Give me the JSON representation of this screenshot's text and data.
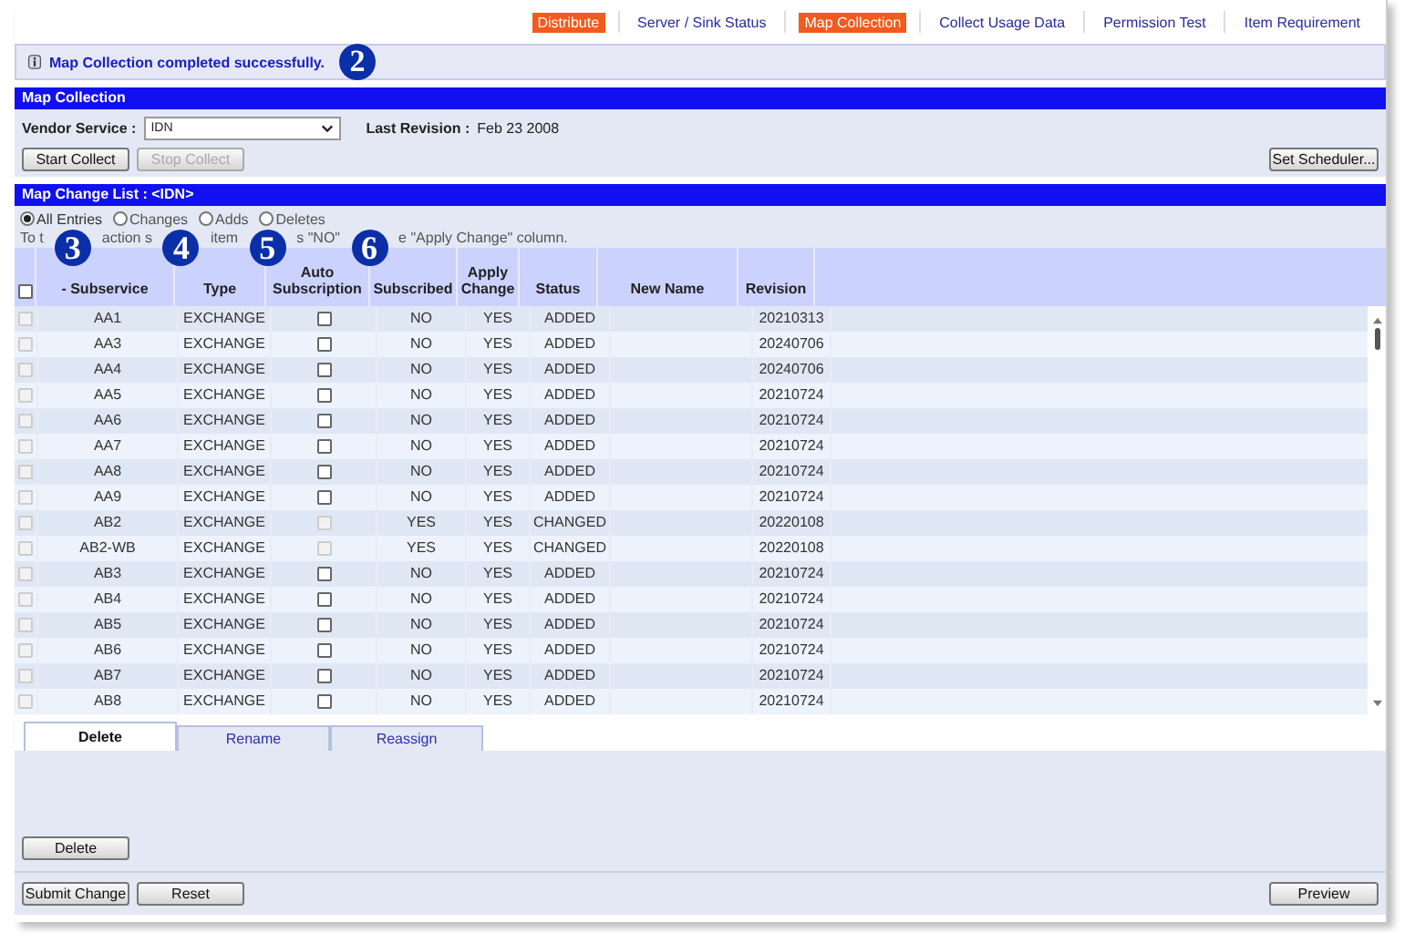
{
  "nav": [
    {
      "label": "Distribute",
      "highlighted": true
    },
    {
      "label": "Server / Sink Status",
      "highlighted": false
    },
    {
      "label": "Map Collection",
      "highlighted": true
    },
    {
      "label": "Collect Usage Data",
      "highlighted": false
    },
    {
      "label": "Permission Test",
      "highlighted": false
    },
    {
      "label": "Item Requirement",
      "highlighted": false
    }
  ],
  "message": {
    "text": "Map Collection completed successfully.",
    "callout": "2"
  },
  "map_collection": {
    "title": "Map Collection",
    "vendor_label": "Vendor Service :",
    "vendor_value": "IDN",
    "revision_label": "Last Revision :",
    "revision_value": "Feb 23 2008",
    "buttons": [
      {
        "label": "Start Collect",
        "disabled": false
      },
      {
        "label": "Stop Collect",
        "disabled": true
      }
    ],
    "scheduler_button": "Set Scheduler..."
  },
  "change_list": {
    "title": "Map Change List : <IDN>",
    "filters": [
      {
        "label": "All Entries",
        "selected": true
      },
      {
        "label": "Changes",
        "selected": false
      },
      {
        "label": "Adds",
        "selected": false
      },
      {
        "label": "Deletes",
        "selected": false
      }
    ],
    "hint_fragments": [
      "To t",
      "action s",
      "item",
      "s \"NO\"",
      "e \"Apply Change\" column."
    ],
    "callouts": [
      "3",
      "4",
      "5",
      "6"
    ],
    "select_all_checked": false,
    "columns": [
      "- Subservice",
      "Type",
      "Auto Subscription",
      "Subscribed",
      "Apply Change",
      "Status",
      "New Name",
      "Revision"
    ],
    "rows": [
      {
        "checked": false,
        "subservice": "AA1",
        "type": "EXCHANGE",
        "auto_checked": false,
        "auto_disabled": false,
        "subscribed": "NO",
        "apply": "YES",
        "status": "ADDED",
        "revision": "20210313"
      },
      {
        "checked": false,
        "subservice": "AA3",
        "type": "EXCHANGE",
        "auto_checked": false,
        "auto_disabled": false,
        "subscribed": "NO",
        "apply": "YES",
        "status": "ADDED",
        "revision": "20240706"
      },
      {
        "checked": false,
        "subservice": "AA4",
        "type": "EXCHANGE",
        "auto_checked": false,
        "auto_disabled": false,
        "subscribed": "NO",
        "apply": "YES",
        "status": "ADDED",
        "revision": "20240706"
      },
      {
        "checked": false,
        "subservice": "AA5",
        "type": "EXCHANGE",
        "auto_checked": false,
        "auto_disabled": false,
        "subscribed": "NO",
        "apply": "YES",
        "status": "ADDED",
        "revision": "20210724"
      },
      {
        "checked": false,
        "subservice": "AA6",
        "type": "EXCHANGE",
        "auto_checked": false,
        "auto_disabled": false,
        "subscribed": "NO",
        "apply": "YES",
        "status": "ADDED",
        "revision": "20210724"
      },
      {
        "checked": false,
        "subservice": "AA7",
        "type": "EXCHANGE",
        "auto_checked": false,
        "auto_disabled": false,
        "subscribed": "NO",
        "apply": "YES",
        "status": "ADDED",
        "revision": "20210724"
      },
      {
        "checked": false,
        "subservice": "AA8",
        "type": "EXCHANGE",
        "auto_checked": false,
        "auto_disabled": false,
        "subscribed": "NO",
        "apply": "YES",
        "status": "ADDED",
        "revision": "20210724"
      },
      {
        "checked": false,
        "subservice": "AA9",
        "type": "EXCHANGE",
        "auto_checked": false,
        "auto_disabled": false,
        "subscribed": "NO",
        "apply": "YES",
        "status": "ADDED",
        "revision": "20210724"
      },
      {
        "checked": false,
        "subservice": "AB2",
        "type": "EXCHANGE",
        "auto_checked": false,
        "auto_disabled": true,
        "subscribed": "YES",
        "apply": "YES",
        "status": "CHANGED",
        "revision": "20220108"
      },
      {
        "checked": false,
        "subservice": "AB2-WB",
        "type": "EXCHANGE",
        "auto_checked": false,
        "auto_disabled": true,
        "subscribed": "YES",
        "apply": "YES",
        "status": "CHANGED",
        "revision": "20220108"
      },
      {
        "checked": false,
        "subservice": "AB3",
        "type": "EXCHANGE",
        "auto_checked": false,
        "auto_disabled": false,
        "subscribed": "NO",
        "apply": "YES",
        "status": "ADDED",
        "revision": "20210724"
      },
      {
        "checked": false,
        "subservice": "AB4",
        "type": "EXCHANGE",
        "auto_checked": false,
        "auto_disabled": false,
        "subscribed": "NO",
        "apply": "YES",
        "status": "ADDED",
        "revision": "20210724"
      },
      {
        "checked": false,
        "subservice": "AB5",
        "type": "EXCHANGE",
        "auto_checked": false,
        "auto_disabled": false,
        "subscribed": "NO",
        "apply": "YES",
        "status": "ADDED",
        "revision": "20210724"
      },
      {
        "checked": false,
        "subservice": "AB6",
        "type": "EXCHANGE",
        "auto_checked": false,
        "auto_disabled": false,
        "subscribed": "NO",
        "apply": "YES",
        "status": "ADDED",
        "revision": "20210724"
      },
      {
        "checked": false,
        "subservice": "AB7",
        "type": "EXCHANGE",
        "auto_checked": false,
        "auto_disabled": false,
        "subscribed": "NO",
        "apply": "YES",
        "status": "ADDED",
        "revision": "20210724"
      },
      {
        "checked": false,
        "subservice": "AB8",
        "type": "EXCHANGE",
        "auto_checked": false,
        "auto_disabled": false,
        "subscribed": "NO",
        "apply": "YES",
        "status": "ADDED",
        "revision": "20210724"
      }
    ]
  },
  "action_tabs": [
    {
      "label": "Delete",
      "selected": true
    },
    {
      "label": "Rename",
      "selected": false
    },
    {
      "label": "Reassign",
      "selected": false
    }
  ],
  "tab_button": "Delete",
  "footer_buttons": [
    "Submit Change",
    "Reset"
  ],
  "preview_button": "Preview"
}
